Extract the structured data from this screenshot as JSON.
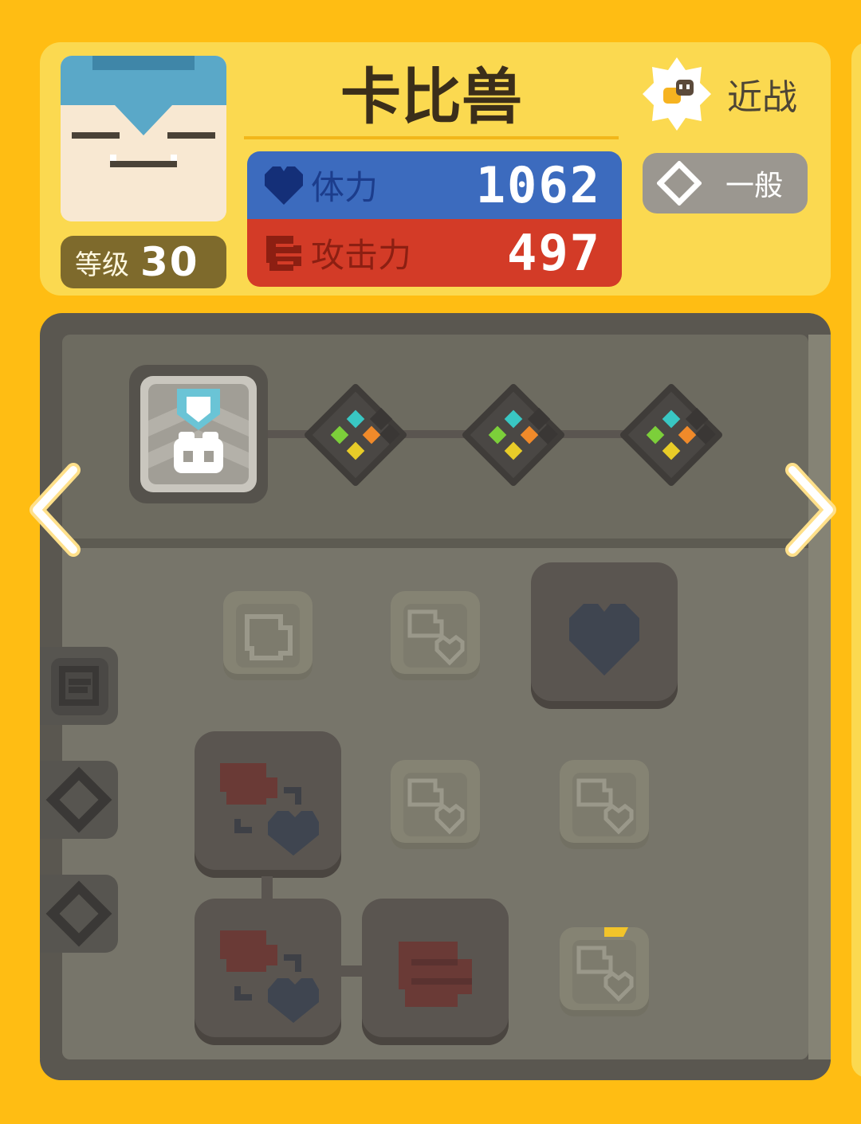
{
  "pokemon": {
    "name": "卡比兽",
    "level_label": "等级",
    "level": "30",
    "attack_type": "近战",
    "rarity": "一般"
  },
  "stats": {
    "hp_label": "体力",
    "hp_value": "1062",
    "attack_label": "攻击力",
    "attack_value": "497"
  },
  "colors": {
    "background": "#ffbd13",
    "header_card": "#fbd950",
    "hp": "#3c6bbe",
    "attack": "#d33b27",
    "board": "#6d6b60"
  },
  "icons": {
    "hp": "heart-icon",
    "attack": "fist-icon",
    "attack_type": "melee-badge-icon",
    "rarity": "diamond-outline-icon",
    "prev": "chevron-left-icon",
    "next": "chevron-right-icon"
  }
}
